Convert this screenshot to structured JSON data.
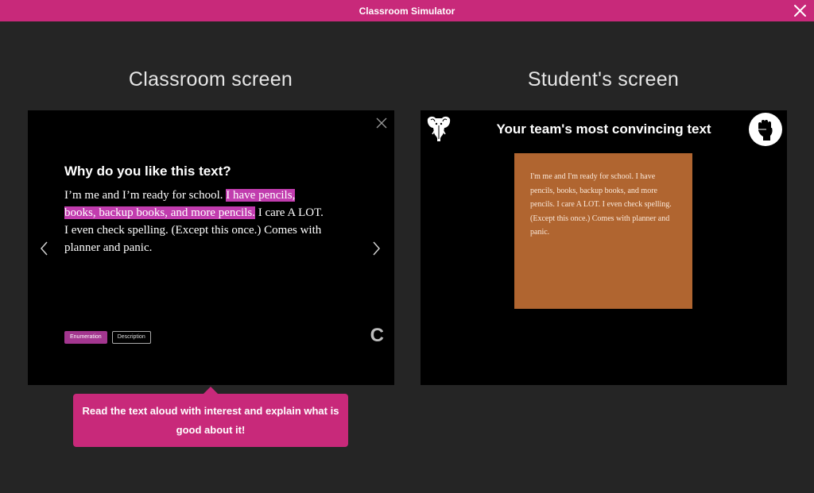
{
  "window": {
    "title": "Classroom Simulator",
    "close_icon": "close-icon"
  },
  "classroom": {
    "heading": "Classroom screen",
    "question": "Why do you like this text?",
    "answer": {
      "before": "I’m me and I’m ready for school. ",
      "highlight": "I have pencils, books, backup books, and more pencils.",
      "after": " I care A LOT. I even check spelling. (Except this once.) Comes with planner and panic."
    },
    "tags": [
      "Enumeration",
      "Description"
    ],
    "logo_letter": "C",
    "highlight_color": "#c13cae"
  },
  "student": {
    "heading": "Student's screen",
    "title": "Your team's most convincing text",
    "card_text": "I'm me and I'm ready for school. I have pencils, books, backup books, and more pencils. I care A LOT. I even check spelling. (Except this once.) Comes with planner and panic.",
    "card_color": "#b06530"
  },
  "tooltip": {
    "text": "Read the text aloud with interest and explain what is good about it!"
  },
  "colors": {
    "accent": "#c8297a",
    "background": "#252525"
  }
}
